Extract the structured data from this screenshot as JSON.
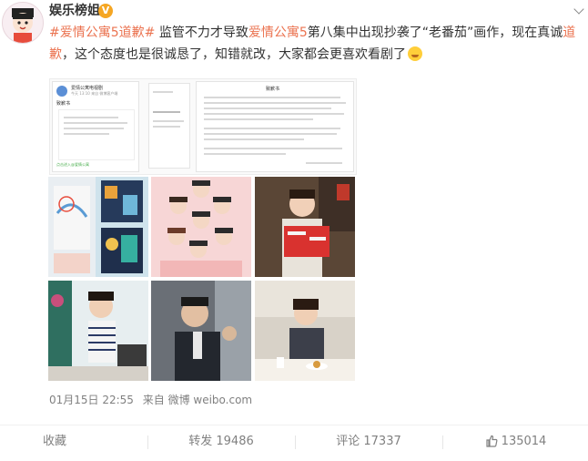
{
  "header": {
    "username": "娱乐榜姐",
    "verified_badge": "V",
    "menu_icon": "chevron-down-icon"
  },
  "post": {
    "tag1": "#爱情公寓5道歉#",
    "text1": " 监管不力才导致",
    "link1": "爱情公寓5",
    "text2": "第八集中出现抄袭了“老番茄”画作，现在真诚",
    "link2": "道歉",
    "text3": "，这个态度也是很诚恳了，知错就改，大家都会更喜欢看剧了",
    "emoji": "smile-emoji-icon"
  },
  "doc_image": {
    "account_name": "爱情公寓电视剧",
    "time_line": "今天 13:10 来自 微博客户端",
    "notice_title": "致歉书",
    "right_title": "致歉书",
    "link_text": "点击进入@爱情公寓"
  },
  "meta": {
    "date": "01月15日 22:55",
    "source": "来自 微博 weibo.com"
  },
  "actions": {
    "favorite": "收藏",
    "repost": "转发 19486",
    "comment": "评论 17337",
    "like": "135014"
  },
  "colors": {
    "accent": "#eb7350",
    "badge": "#f5a623",
    "muted": "#808080"
  }
}
